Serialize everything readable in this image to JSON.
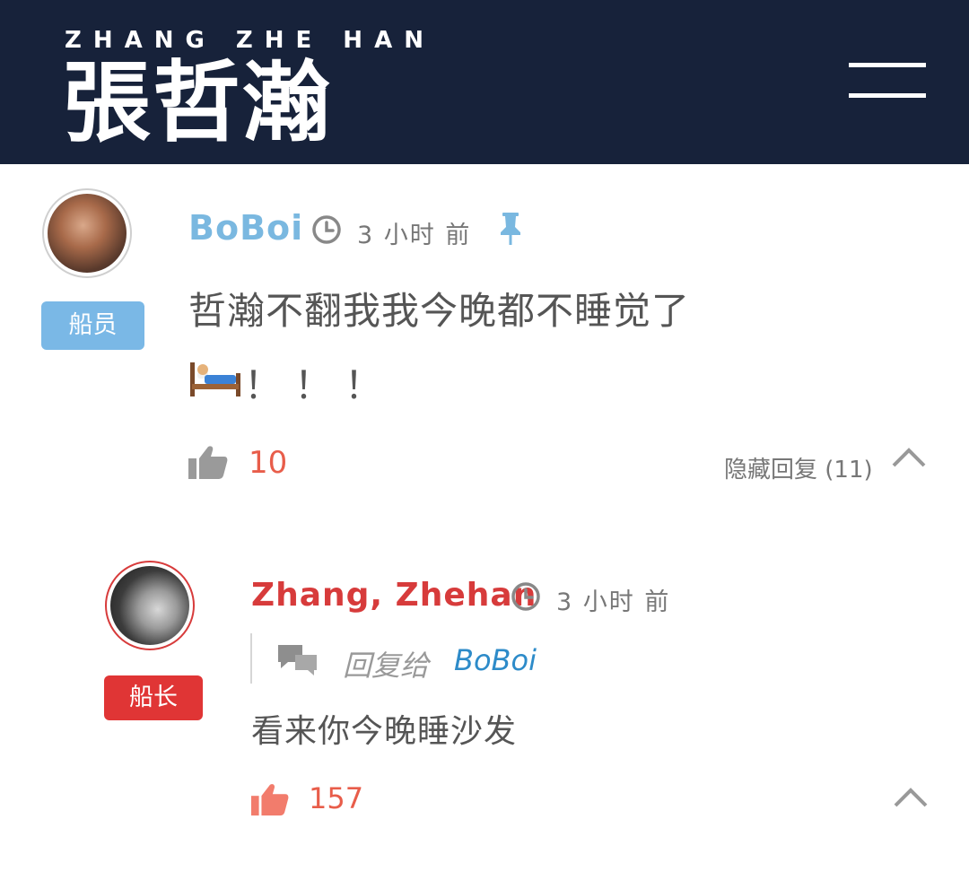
{
  "header": {
    "brand_latin": "ZHANG ZHE HAN",
    "brand_cjk": "張哲瀚"
  },
  "comments": [
    {
      "author": "BoBoi",
      "author_color": "#7ab8e0",
      "time": "3 小时 前",
      "badge": "船员",
      "badge_color": "#7ab8e6",
      "pinned": true,
      "text_line1": "哲瀚不翻我我今晚都不睡觉了",
      "text_line2_emoji": "bed-icon",
      "text_line2": "！！！",
      "likes": "10",
      "replies_toggle": "隐藏回复 (11)"
    },
    {
      "author": "Zhang, Zhehan",
      "author_color": "#d73b3b",
      "time": "3 小时 前",
      "badge": "船长",
      "badge_color": "#e03535",
      "reply_prefix": "回复给",
      "reply_to": "BoBoi",
      "text": "看来你今晚睡沙发",
      "likes": "157"
    }
  ]
}
